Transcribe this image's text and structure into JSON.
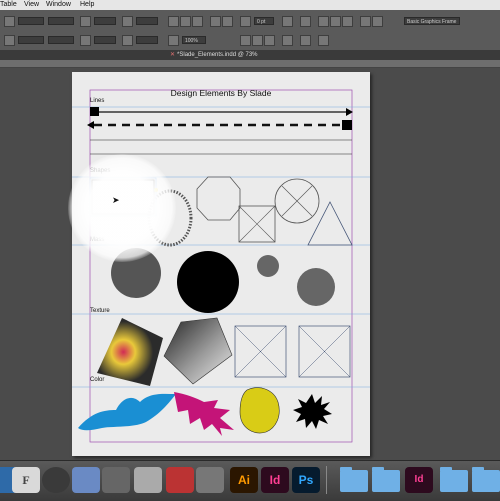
{
  "menu": {
    "items": [
      "Table",
      "View",
      "Window",
      "Help"
    ]
  },
  "control_panel": {
    "workspace_label": "Basic Graphics Frame",
    "fill_value": "0 pt",
    "zoom_value": "100%"
  },
  "document": {
    "tab_title": "*Slade_Elements.indd @ 73%"
  },
  "page": {
    "title": "Design Elements By Slade",
    "sections": {
      "lines": "Lines",
      "shapes": "Shapes",
      "mass": "Mass",
      "texture": "Texture",
      "color": "Color"
    }
  },
  "dock": {
    "apps": [
      "Ai",
      "Id",
      "Ps"
    ]
  },
  "colors": {
    "illustrator": "#ff9a00",
    "indesign": "#ff3f94",
    "photoshop": "#31a8ff"
  }
}
